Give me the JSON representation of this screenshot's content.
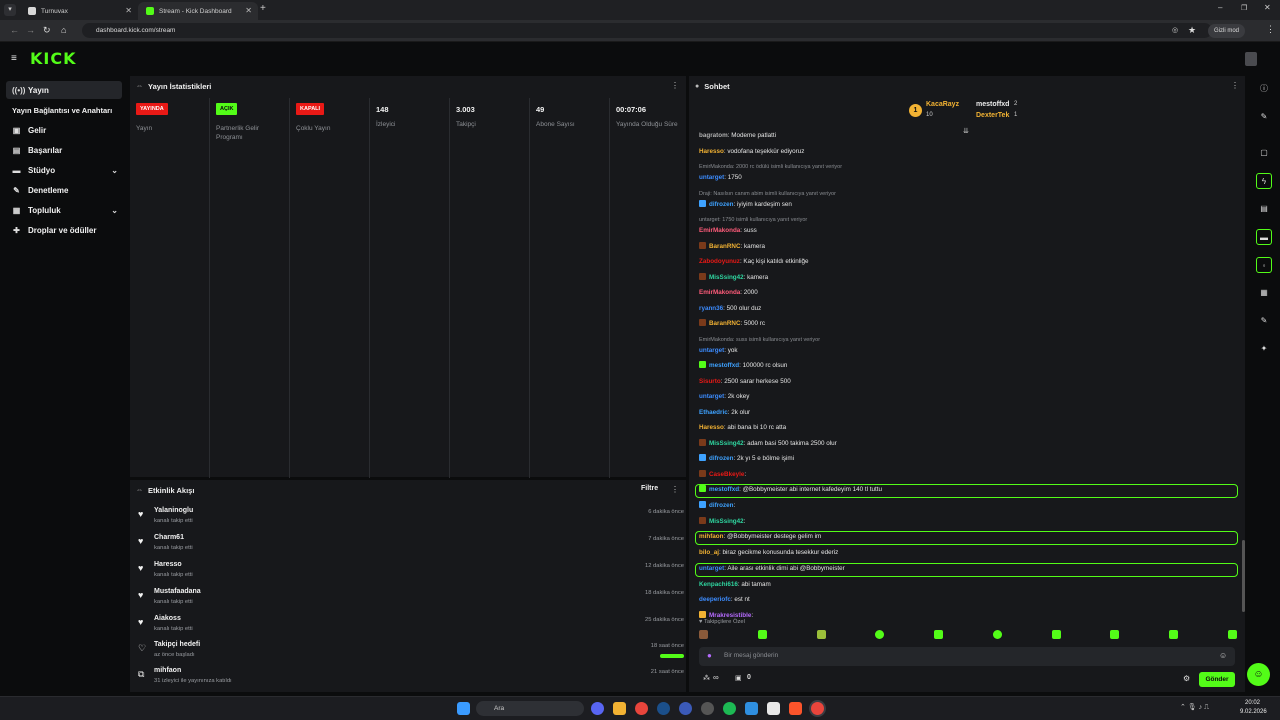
{
  "browser": {
    "tabs": [
      {
        "title": "Turnuvax"
      },
      {
        "title": "Stream - Kick Dashboard"
      }
    ],
    "url": "dashboard.kick.com/stream",
    "incognito_label": "Gizli mod"
  },
  "brand": {
    "logo": "KICK",
    "accent": "#53fc18"
  },
  "sidebar": {
    "items": [
      {
        "label": "Yayın",
        "icon": "broadcast-icon"
      },
      {
        "label": "Yayın Bağlantısı ve Anahtarı",
        "icon": ""
      },
      {
        "label": "Gelir",
        "icon": "wallet-icon"
      },
      {
        "label": "Başarılar",
        "icon": "trophy-icon"
      },
      {
        "label": "Stüdyo",
        "icon": "studio-icon"
      },
      {
        "label": "Denetleme",
        "icon": "wrench-icon"
      },
      {
        "label": "Topluluk",
        "icon": "community-icon"
      },
      {
        "label": "Droplar ve ödüller",
        "icon": "gift-icon"
      }
    ]
  },
  "stats": {
    "title": "Yayın İstatistikleri",
    "columns": [
      {
        "badge": "YAYINDA",
        "badge_color": "#e91916",
        "label": "Yayın"
      },
      {
        "badge": "AÇIK",
        "badge_color": "#53fc18",
        "label": "Partnerlik Gelir Programı"
      },
      {
        "badge": "KAPALI",
        "badge_color": "#e91916",
        "label": "Çoklu Yayın"
      },
      {
        "value": "148",
        "label": "İzleyici"
      },
      {
        "value": "3.003",
        "label": "Takipçi"
      },
      {
        "value": "49",
        "label": "Abone Sayısı"
      },
      {
        "value": "00:07:06",
        "label": "Yayında Olduğu Süre"
      }
    ]
  },
  "activity": {
    "title": "Etkinlik Akışı",
    "filter_label": "Filtre",
    "items": [
      {
        "name": "Yalaninoglu",
        "sub": "kanalı takip etti",
        "time": "6 dakika önce"
      },
      {
        "name": "Charm61",
        "sub": "kanalı takip etti",
        "time": "7 dakika önce"
      },
      {
        "name": "Haresso",
        "sub": "kanalı takip etti",
        "time": "12 dakika önce"
      },
      {
        "name": "Mustafaadana",
        "sub": "kanalı takip etti",
        "time": "18 dakika önce"
      },
      {
        "name": "Aiakoss",
        "sub": "kanalı takip etti",
        "time": "25 dakika önce"
      },
      {
        "name": "Takipçi hedefi",
        "sub": "az önce başladı",
        "time": "18 saat önce"
      },
      {
        "name": "mihfaon",
        "sub": "31 izleyici ile yayınınıza katıldı",
        "time": "21 saat önce"
      }
    ]
  },
  "chat": {
    "title": "Sohbet",
    "leaderboard": {
      "first": {
        "rank": "1",
        "name": "KacaRayz",
        "count": "10"
      },
      "second": {
        "name": "mestoffxd",
        "count": "2"
      },
      "third": {
        "name": "DexterTek",
        "count": "1"
      }
    },
    "messages": [
      {
        "user": "bagratom",
        "color": "#b0b0b0",
        "text": ": Modeme patlatti",
        "badge": ""
      },
      {
        "user": "Haresso",
        "color": "#f2b233",
        "text": ": vodofana teşekkür ediyoruz",
        "badge": ""
      },
      {
        "reply": "EmirMakonda: 2000 rc ödülü isimli kullanıcıya yanıt veriyor"
      },
      {
        "user": "untarget",
        "color": "#3c8cff",
        "text": ": 1750",
        "badge": ""
      },
      {
        "reply": "Draji: Nasılsın canım abim isimli kullanıcıya yanıt veriyor"
      },
      {
        "user": "difrozen",
        "color": "#3ea2ff",
        "text": ": iyiyim kardeşim sen",
        "badge": "#3ea2ff"
      },
      {
        "reply": "untarget: 1750 isimli kullanıcıya yanıt veriyor"
      },
      {
        "user": "EmirMakonda",
        "color": "#ff5c7a",
        "text": ": suss",
        "badge": ""
      },
      {
        "user": "BaranRNC",
        "color": "#f2b233",
        "text": ": kamera",
        "badge": "#7a3a1a"
      },
      {
        "user": "Zabodoyunuz",
        "color": "#e91916",
        "text": ": Kaç kişi katıldı etkinliğe",
        "badge": ""
      },
      {
        "user": "MisSsing42",
        "color": "#2fd6a0",
        "text": ": kamera",
        "badge": "#7a3a1a"
      },
      {
        "user": "EmirMakonda",
        "color": "#ff5c7a",
        "text": ": 2000",
        "badge": ""
      },
      {
        "user": "ryann36",
        "color": "#3c8cff",
        "text": ": 500 olur duz",
        "badge": ""
      },
      {
        "user": "BaranRNC",
        "color": "#f2b233",
        "text": ": 5000 rc",
        "badge": "#7a3a1a"
      },
      {
        "reply": "EmirMakonda: suss isimli kullanıcıya yanıt veriyor"
      },
      {
        "user": "untarget",
        "color": "#3c8cff",
        "text": ": yok",
        "badge": ""
      },
      {
        "user": "mestoffxd",
        "color": "#3ea2ff",
        "text": ": 100000 rc olsun",
        "badge": "#53fc18"
      },
      {
        "user": "Sisurto",
        "color": "#e91916",
        "text": ": 2500 sarar herkese 500",
        "badge": ""
      },
      {
        "user": "untarget",
        "color": "#3c8cff",
        "text": ": 2k okey",
        "badge": ""
      },
      {
        "user": "Ethaedric",
        "color": "#3ea2ff",
        "text": ": 2k olur",
        "badge": ""
      },
      {
        "user": "Haresso",
        "color": "#f2b233",
        "text": ": abi bana bi 10 rc atta",
        "badge": ""
      },
      {
        "user": "MisSsing42",
        "color": "#2fd6a0",
        "text": ": adam basi 500 takima 2500 olur",
        "badge": "#7a3a1a"
      },
      {
        "user": "difrozen",
        "color": "#3ea2ff",
        "text": ": 2k yı 5 e bölme işimi",
        "badge": "#3ea2ff"
      },
      {
        "user": "CaseBkeyle",
        "color": "#e91916",
        "text": ":",
        "badge": "#7a3a1a"
      },
      {
        "user": "mestoffxd",
        "color": "#3ea2ff",
        "text": ": @Bobbymeister abi internet kafedeyim 140 tl tuttu",
        "badge": "#53fc18",
        "highlight": true
      },
      {
        "user": "difrozen",
        "color": "#3ea2ff",
        "text": ":",
        "badge": "#3ea2ff"
      },
      {
        "user": "MisSsing42",
        "color": "#2fd6a0",
        "text": ":",
        "badge": "#7a3a1a"
      },
      {
        "user": "mihfaon",
        "color": "#f2b233",
        "text": ": @Bobbymeister destege gelim im",
        "badge": "",
        "highlight": true
      },
      {
        "user": "bilo_aj",
        "color": "#f2b233",
        "text": ": biraz gecikme konusunda tesekkur ederiz",
        "badge": ""
      },
      {
        "user": "untarget",
        "color": "#3c8cff",
        "text": ": Aile arası etkinlik dimi abi @Bobbymeister",
        "badge": "",
        "highlight": true
      },
      {
        "user": "Kenpachi616",
        "color": "#2fd6a0",
        "text": ": abi tamam",
        "badge": ""
      },
      {
        "user": "deeperiofc",
        "color": "#3c8cff",
        "text": ": est nt",
        "badge": ""
      },
      {
        "user": "Mrakresistible",
        "color": "#b66bff",
        "text": ":",
        "badge": "#f2b233"
      }
    ],
    "followers_only_label": "Takipçilere Özel",
    "input_placeholder": "Bir mesaj gönderin",
    "send_label": "Gönder",
    "infinite_label": "∞",
    "gift_count": "0"
  },
  "taskbar": {
    "search_label": "Ara",
    "time": "20:02",
    "date": "9.02.2026"
  }
}
